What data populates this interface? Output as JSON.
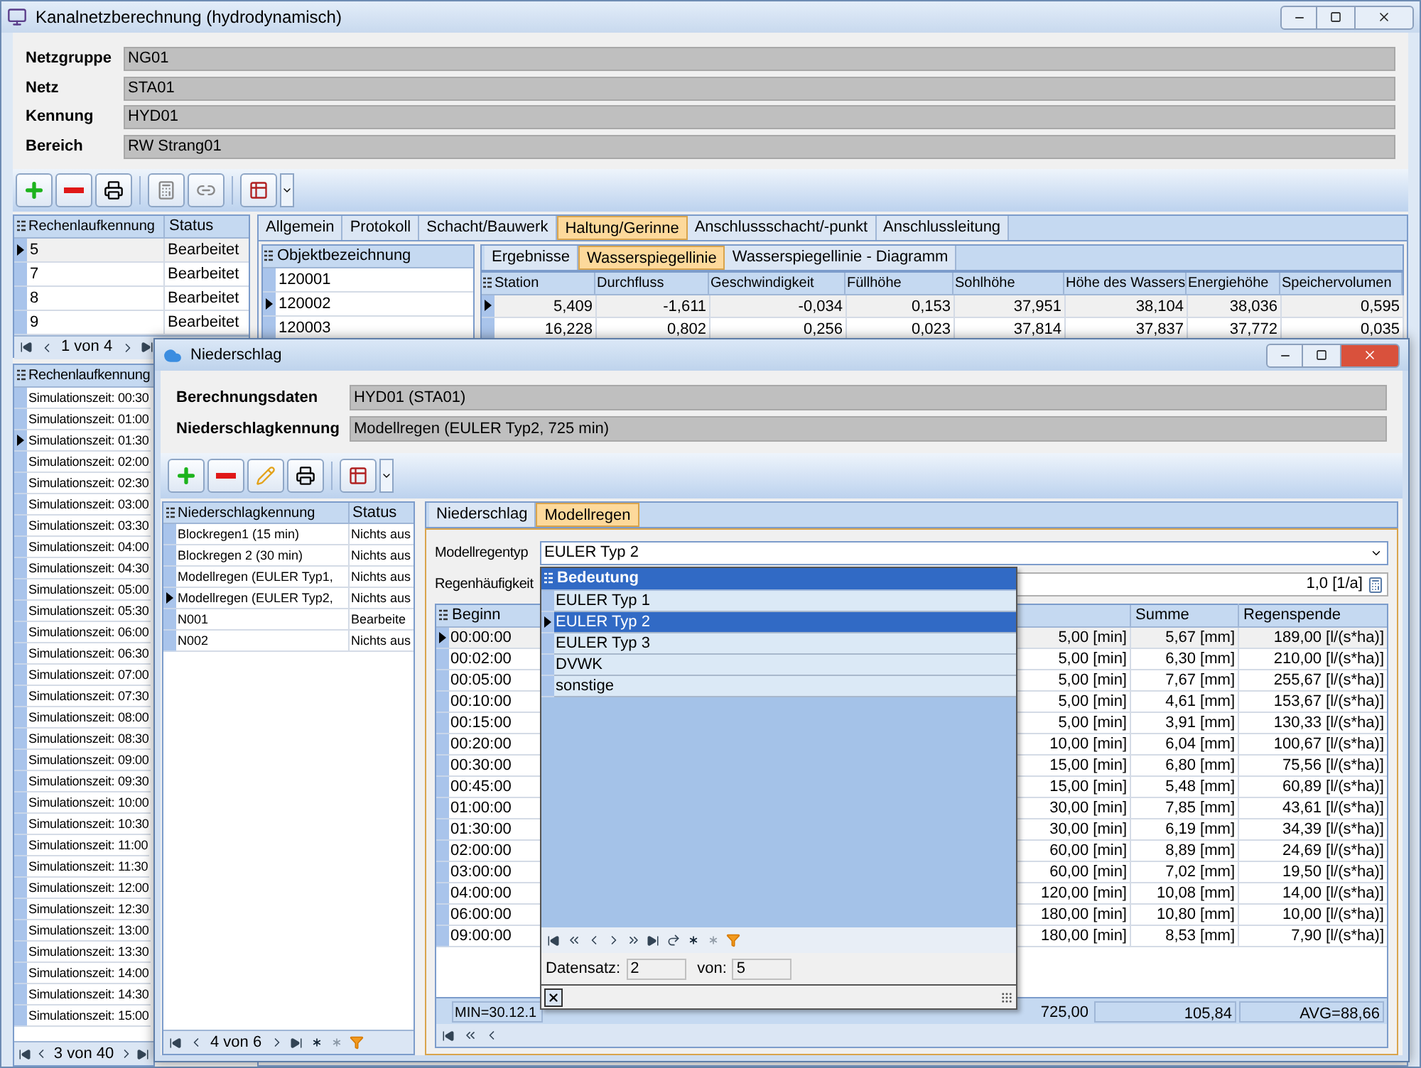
{
  "window": {
    "title": "Kanalnetzberechnung (hydrodynamisch)"
  },
  "header_fields": [
    {
      "label": "Netzgruppe",
      "value": "NG01"
    },
    {
      "label": "Netz",
      "value": "STA01"
    },
    {
      "label": "Kennung",
      "value": "HYD01"
    },
    {
      "label": "Bereich",
      "value": "RW Strang01"
    }
  ],
  "runs_table": {
    "columns": [
      "Rechenlaufkennung",
      "Status"
    ],
    "rows": [
      {
        "cells": [
          "5",
          "Bearbeitet"
        ],
        "selected": true
      },
      {
        "cells": [
          "7",
          "Bearbeitet"
        ],
        "selected": false
      },
      {
        "cells": [
          "8",
          "Bearbeitet"
        ],
        "selected": false
      },
      {
        "cells": [
          "9",
          "Bearbeitet"
        ],
        "selected": false
      }
    ],
    "pager": "1 von 4"
  },
  "main_tabs": [
    {
      "label": "Allgemein",
      "selected": false
    },
    {
      "label": "Protokoll",
      "selected": false
    },
    {
      "label": "Schacht/Bauwerk",
      "selected": false
    },
    {
      "label": "Haltung/Gerinne",
      "selected": true
    },
    {
      "label": "Anschlussschacht/-punkt",
      "selected": false
    },
    {
      "label": "Anschlussleitung",
      "selected": false
    }
  ],
  "objects": {
    "column": "Objektbezeichnung",
    "rows": [
      {
        "label": "120001",
        "selected": false
      },
      {
        "label": "120002",
        "selected": true
      },
      {
        "label": "120003",
        "selected": false
      }
    ]
  },
  "sub_tabs": [
    {
      "label": "Ergebnisse",
      "selected": false
    },
    {
      "label": "Wasserspiegellinie",
      "selected": true
    },
    {
      "label": "Wasserspiegellinie - Diagramm",
      "selected": false
    }
  ],
  "results_table": {
    "columns": [
      "Station",
      "Durchfluss",
      "Geschwindigkeit",
      "Füllhöhe",
      "Sohlhöhe",
      "Höhe des Wassers",
      "Energiehöhe",
      "Speichervolumen"
    ],
    "rows": [
      {
        "cells": [
          "5,409",
          "-1,611",
          "-0,034",
          "0,153",
          "37,951",
          "38,104",
          "38,036",
          "0,595"
        ],
        "selected": true
      },
      {
        "cells": [
          "16,228",
          "0,802",
          "0,256",
          "0,023",
          "37,814",
          "37,837",
          "37,772",
          "0,035"
        ],
        "selected": false
      }
    ]
  },
  "sim_list": {
    "column": "Rechenlaufkennung",
    "pager": "3 von 40",
    "rows": [
      {
        "label": "Simulationszeit: 00:30",
        "selected": false
      },
      {
        "label": "Simulationszeit: 01:00",
        "selected": false
      },
      {
        "label": "Simulationszeit: 01:30",
        "selected": true
      },
      {
        "label": "Simulationszeit: 02:00",
        "selected": false
      },
      {
        "label": "Simulationszeit: 02:30",
        "selected": false
      },
      {
        "label": "Simulationszeit: 03:00",
        "selected": false
      },
      {
        "label": "Simulationszeit: 03:30",
        "selected": false
      },
      {
        "label": "Simulationszeit: 04:00",
        "selected": false
      },
      {
        "label": "Simulationszeit: 04:30",
        "selected": false
      },
      {
        "label": "Simulationszeit: 05:00",
        "selected": false
      },
      {
        "label": "Simulationszeit: 05:30",
        "selected": false
      },
      {
        "label": "Simulationszeit: 06:00",
        "selected": false
      },
      {
        "label": "Simulationszeit: 06:30",
        "selected": false
      },
      {
        "label": "Simulationszeit: 07:00",
        "selected": false
      },
      {
        "label": "Simulationszeit: 07:30",
        "selected": false
      },
      {
        "label": "Simulationszeit: 08:00",
        "selected": false
      },
      {
        "label": "Simulationszeit: 08:30",
        "selected": false
      },
      {
        "label": "Simulationszeit: 09:00",
        "selected": false
      },
      {
        "label": "Simulationszeit: 09:30",
        "selected": false
      },
      {
        "label": "Simulationszeit: 10:00",
        "selected": false
      },
      {
        "label": "Simulationszeit: 10:30",
        "selected": false
      },
      {
        "label": "Simulationszeit: 11:00",
        "selected": false
      },
      {
        "label": "Simulationszeit: 11:30",
        "selected": false
      },
      {
        "label": "Simulationszeit: 12:00",
        "selected": false
      },
      {
        "label": "Simulationszeit: 12:30",
        "selected": false
      },
      {
        "label": "Simulationszeit: 13:00",
        "selected": false
      },
      {
        "label": "Simulationszeit: 13:30",
        "selected": false
      },
      {
        "label": "Simulationszeit: 14:00",
        "selected": false
      },
      {
        "label": "Simulationszeit: 14:30",
        "selected": false
      },
      {
        "label": "Simulationszeit: 15:00",
        "selected": false
      }
    ]
  },
  "dialog": {
    "title": "Niederschlag",
    "fields": [
      {
        "label": "Berechnungsdaten",
        "value": "HYD01 (STA01)"
      },
      {
        "label": "Niederschlagkennung",
        "value": "Modellregen (EULER Typ2, 725 min)"
      }
    ],
    "list": {
      "columns": [
        "Niederschlagkennung",
        "Status"
      ],
      "pager": "4 von 6",
      "rows": [
        {
          "cells": [
            "Blockregen1 (15 min)",
            "Nichts aus"
          ],
          "selected": false
        },
        {
          "cells": [
            "Blockregen 2 (30 min)",
            "Nichts aus"
          ],
          "selected": false
        },
        {
          "cells": [
            "Modellregen (EULER Typ1,",
            "Nichts aus"
          ],
          "selected": false
        },
        {
          "cells": [
            "Modellregen (EULER Typ2,",
            "Nichts aus"
          ],
          "selected": true
        },
        {
          "cells": [
            "N001",
            "Bearbeite"
          ],
          "selected": false
        },
        {
          "cells": [
            "N002",
            "Nichts aus"
          ],
          "selected": false
        }
      ]
    },
    "tabs": [
      {
        "label": "Niederschlag",
        "selected": false
      },
      {
        "label": "Modellregen",
        "selected": true
      }
    ],
    "model_type": {
      "label": "Modellregentyp",
      "value": "EULER Typ 2"
    },
    "frequency": {
      "label": "Regenhäufigkeit",
      "value": "1,0 [1/a]"
    },
    "table": {
      "column_headings": [
        "Beginn",
        "Summe",
        "Regenspende"
      ],
      "rows": [
        {
          "beginn": "00:00:00",
          "column_2": "5,00 [min]",
          "summe": "5,67 [mm]",
          "regenspende": "189,00 [l/(s*ha)]",
          "selected": true
        },
        {
          "beginn": "00:02:00",
          "column_2": "5,00 [min]",
          "summe": "6,30 [mm]",
          "regenspende": "210,00 [l/(s*ha)]",
          "selected": false
        },
        {
          "beginn": "00:05:00",
          "column_2": "5,00 [min]",
          "summe": "7,67 [mm]",
          "regenspende": "255,67 [l/(s*ha)]",
          "selected": false
        },
        {
          "beginn": "00:10:00",
          "column_2": "5,00 [min]",
          "summe": "4,61 [mm]",
          "regenspende": "153,67 [l/(s*ha)]",
          "selected": false
        },
        {
          "beginn": "00:15:00",
          "column_2": "5,00 [min]",
          "summe": "3,91 [mm]",
          "regenspende": "130,33 [l/(s*ha)]",
          "selected": false
        },
        {
          "beginn": "00:20:00",
          "column_2": "10,00 [min]",
          "summe": "6,04 [mm]",
          "regenspende": "100,67 [l/(s*ha)]",
          "selected": false
        },
        {
          "beginn": "00:30:00",
          "column_2": "15,00 [min]",
          "summe": "6,80 [mm]",
          "regenspende": "75,56 [l/(s*ha)]",
          "selected": false
        },
        {
          "beginn": "00:45:00",
          "column_2": "15,00 [min]",
          "summe": "5,48 [mm]",
          "regenspende": "60,89 [l/(s*ha)]",
          "selected": false
        },
        {
          "beginn": "01:00:00",
          "column_2": "30,00 [min]",
          "summe": "7,85 [mm]",
          "regenspende": "43,61 [l/(s*ha)]",
          "selected": false
        },
        {
          "beginn": "01:30:00",
          "column_2": "30,00 [min]",
          "summe": "6,19 [mm]",
          "regenspende": "34,39 [l/(s*ha)]",
          "selected": false
        },
        {
          "beginn": "02:00:00",
          "column_2": "60,00 [min]",
          "summe": "8,89 [mm]",
          "regenspende": "24,69 [l/(s*ha)]",
          "selected": false
        },
        {
          "beginn": "03:00:00",
          "column_2": "60,00 [min]",
          "summe": "7,02 [mm]",
          "regenspende": "19,50 [l/(s*ha)]",
          "selected": false
        },
        {
          "beginn": "04:00:00",
          "column_2": "120,00 [min]",
          "summe": "10,08 [mm]",
          "regenspende": "14,00 [l/(s*ha)]",
          "selected": false
        },
        {
          "beginn": "06:00:00",
          "column_2": "180,00 [min]",
          "summe": "10,80 [mm]",
          "regenspende": "10,00 [l/(s*ha)]",
          "selected": false
        },
        {
          "beginn": "09:00:00",
          "column_2": "180,00 [min]",
          "summe": "8,53 [mm]",
          "regenspende": "7,90 [l/(s*ha)]",
          "selected": false
        }
      ],
      "footer": [
        "MIN=30.12.1",
        "725,00",
        "105,84",
        "AVG=88,66"
      ]
    },
    "dropdown": {
      "column": "Bedeutung",
      "items": [
        {
          "label": "EULER Typ 1",
          "selected": false
        },
        {
          "label": "EULER Typ 2",
          "selected": true
        },
        {
          "label": "EULER Typ 3",
          "selected": false
        },
        {
          "label": "DVWK",
          "selected": false
        },
        {
          "label": "sonstige",
          "selected": false
        }
      ],
      "record_label": "Datensatz:",
      "record": "2",
      "of_label": "von:",
      "total": "5"
    }
  }
}
